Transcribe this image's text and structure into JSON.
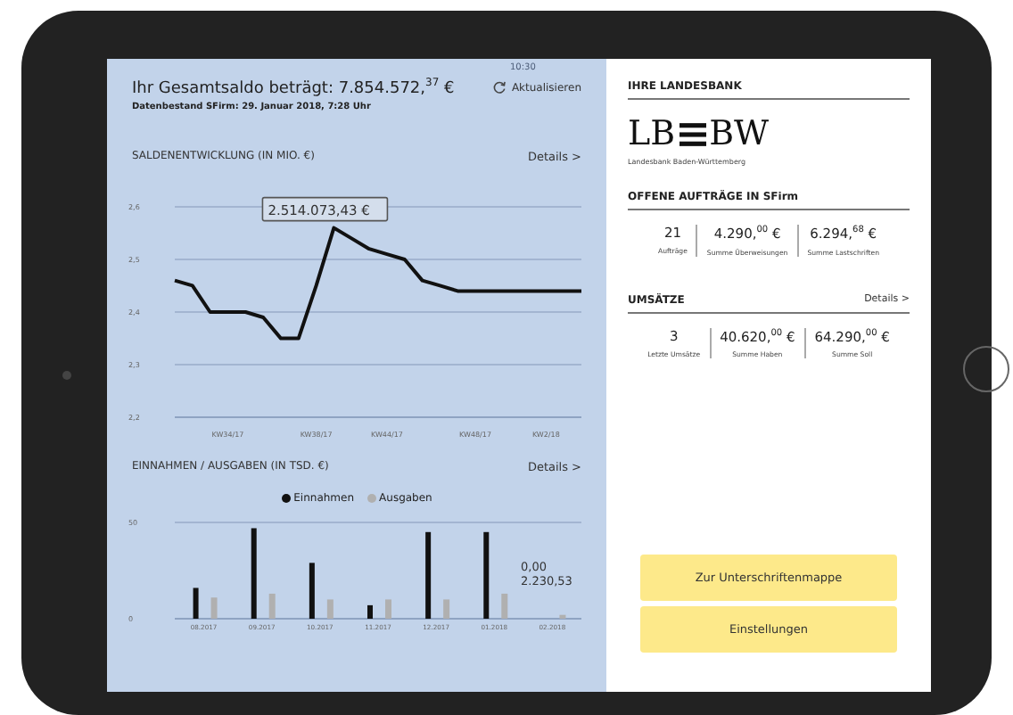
{
  "status_bar": {
    "time": "10:30"
  },
  "balance": {
    "title": "Ihr Gesamtsaldo beträgt: 7.854.572,$^{37}$ €",
    "refresh_label": "Aktualisieren",
    "data_as_of": "Datenbestand SFirm: 29. Januar 2018, 7:28 Uhr"
  },
  "balance_chart": {
    "heading": "SALDENENTWICKLUNG (IN MIO. €)",
    "details_link": "Details >",
    "chart_data": {
      "type": "line",
      "categories": [
        null,
        null,
        null,
        "KW34/17",
        null,
        null,
        null,
        null,
        "KW38/17",
        null,
        null,
        null,
        "KW44/17",
        null,
        null,
        null,
        null,
        "KW48/17",
        null,
        null,
        null,
        "KW2/18",
        null,
        null
      ],
      "series": [
        {
          "color": "#111111",
          "values": [
            2.46,
            2.45,
            2.4,
            2.4,
            2.4,
            2.39,
            2.35,
            2.35,
            2.45,
            2.56,
            2.54,
            2.52,
            2.51,
            2.5,
            2.46,
            2.45,
            2.44,
            2.44,
            2.44,
            2.44,
            2.44,
            2.44,
            2.44,
            2.44
          ]
        }
      ],
      "ylim": [
        2.2,
        2.6
      ],
      "yticks": [
        {
          "value": 2.6,
          "label": "2,6"
        },
        {
          "value": 2.5,
          "label": "2,5"
        },
        {
          "value": 2.4,
          "label": "2,4"
        },
        {
          "value": 2.3,
          "label": "2,3"
        },
        {
          "value": 2.2,
          "label": "2,2"
        }
      ],
      "grid": true,
      "annotations": [
        {
          "text": "2.514.073,43  €"
        }
      ]
    }
  },
  "income_chart": {
    "heading": "EINNAHMEN / AUSGABEN (IN TSD. €)",
    "details_link": "Details >",
    "chart_data": {
      "type": "bar",
      "categories": [
        "08.2017",
        "09.2017",
        "10.2017",
        "11.2017",
        "12.2017",
        "01.2018",
        "02.2018"
      ],
      "series": [
        {
          "name": "Einnahmen",
          "color": "#111111",
          "values": [
            16,
            47,
            29,
            7,
            45,
            45,
            0
          ]
        },
        {
          "name": "Ausgaben",
          "color": "#b0b0b0",
          "values": [
            11,
            13,
            10,
            10,
            10,
            13,
            2
          ]
        }
      ],
      "ylim": [
        0,
        50
      ],
      "yticks": [
        0,
        50
      ],
      "annotations": [
        {
          "text": "0,00"
        },
        {
          "text": "2.230,53"
        }
      ]
    }
  },
  "bank": {
    "heading": "IHRE LANDESBANK",
    "logo_left": "LB",
    "logo_right": "BW",
    "logo_caption": "Landesbank Baden-Württemberg"
  },
  "open_orders": {
    "heading": "OFFENE AUFTRÄGE IN SFirm",
    "stats": [
      {
        "value": "21",
        "label": "Aufträge"
      },
      {
        "value": "4.290,$^{00}$ €",
        "label": "Summe Überweisungen"
      },
      {
        "value": "6.294,$^{68}$ €",
        "label": "Summe Lastschriften"
      }
    ]
  },
  "transactions": {
    "heading": "UMSÄTZE",
    "details_link": "Details >",
    "stats": [
      {
        "value": "3",
        "label": "Letzte Umsätze"
      },
      {
        "value": "40.620,$^{00}$ €",
        "label": "Summe Haben"
      },
      {
        "value": "64.290,$^{00}$ €",
        "label": "Summe Soll"
      }
    ]
  },
  "buttons": [
    "Zur Unterschriftenmappe",
    "Einstellungen"
  ]
}
